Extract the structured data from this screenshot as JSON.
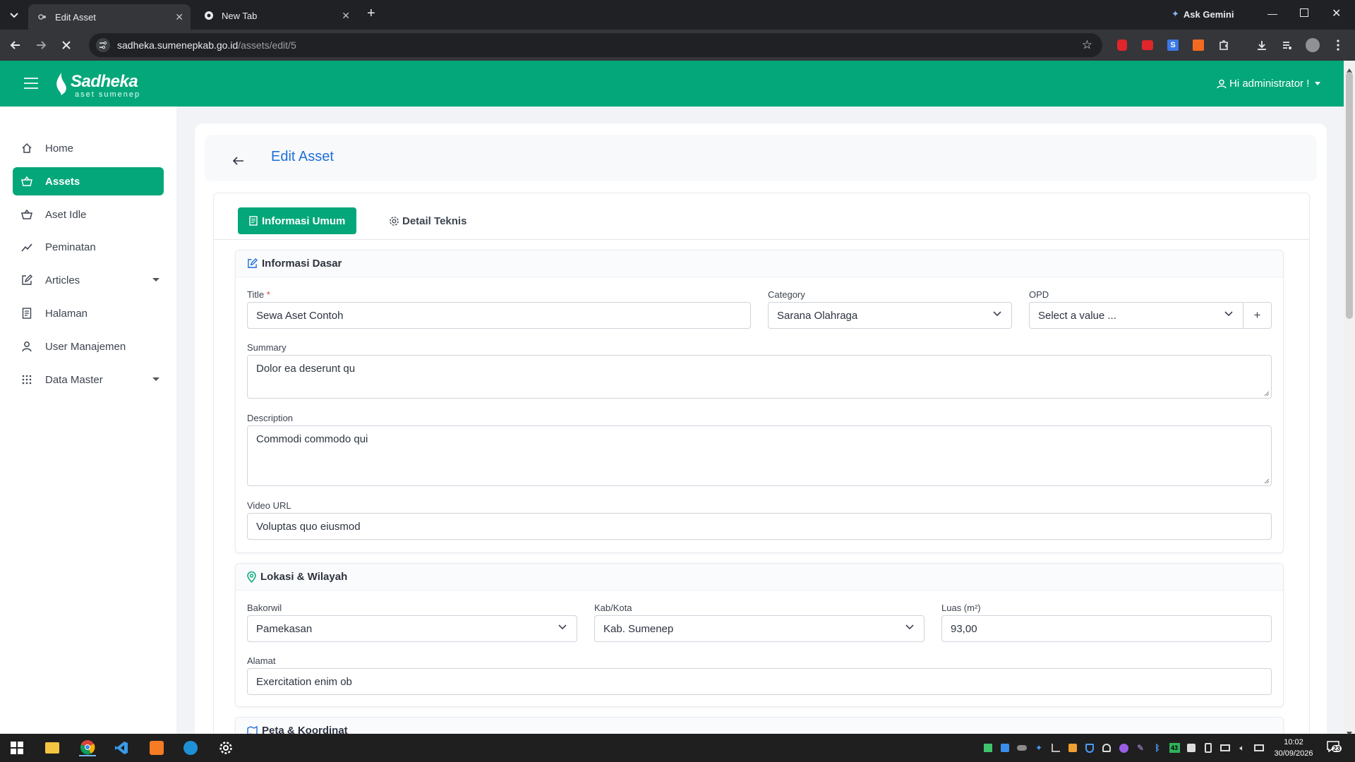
{
  "browser": {
    "tabs": [
      {
        "label": "Edit Asset",
        "active": true
      },
      {
        "label": "New Tab",
        "active": false
      }
    ],
    "new_tab_symbol": "+",
    "ask_gemini": "Ask Gemini",
    "url_host": "sadheka.sumenepkab.go.id",
    "url_path": "/assets/edit/5"
  },
  "header": {
    "logo_main": "Sadheka",
    "logo_sub": "aset sumenep",
    "user_greeting": "Hi administrator !"
  },
  "sidebar": {
    "items": [
      {
        "label": "Home",
        "icon": "home-icon"
      },
      {
        "label": "Assets",
        "icon": "basket-icon",
        "active": true
      },
      {
        "label": "Aset Idle",
        "icon": "basket-icon"
      },
      {
        "label": "Peminatan",
        "icon": "trend-icon"
      },
      {
        "label": "Articles",
        "icon": "edit-icon",
        "has_caret": true
      },
      {
        "label": "Halaman",
        "icon": "document-icon"
      },
      {
        "label": "User Manajemen",
        "icon": "user-icon"
      },
      {
        "label": "Data Master",
        "icon": "grid-icon",
        "has_caret": true
      }
    ]
  },
  "page": {
    "title": "Edit Asset",
    "tabs": [
      {
        "label": "Informasi Umum",
        "active": true
      },
      {
        "label": "Detail Teknis",
        "active": false
      }
    ]
  },
  "informasi_dasar": {
    "heading": "Informasi Dasar",
    "title_label": "Title",
    "required_mark": "*",
    "title_value": "Sewa Aset Contoh",
    "category_label": "Category",
    "category_value": "Sarana Olahraga",
    "opd_label": "OPD",
    "opd_placeholder": "Select a value ...",
    "opd_add": "+",
    "summary_label": "Summary",
    "summary_value": "Dolor ea deserunt qu",
    "description_label": "Description",
    "description_value": "Commodi commodo qui",
    "video_label": "Video URL",
    "video_value": "Voluptas quo eiusmod"
  },
  "lokasi": {
    "heading": "Lokasi & Wilayah",
    "bakorwil_label": "Bakorwil",
    "bakorwil_value": "Pamekasan",
    "kabkota_label": "Kab/Kota",
    "kabkota_value": "Kab. Sumenep",
    "luas_label": "Luas (m²)",
    "luas_value": "93,00",
    "alamat_label": "Alamat",
    "alamat_value": "Exercitation enim ob"
  },
  "next_section": {
    "heading": "Peta & Koordinat"
  },
  "taskbar": {
    "time": "10:02",
    "date": "30/09/2026",
    "notif_count": "23",
    "tray_badge": "43"
  },
  "colors": {
    "brand": "#04a77a",
    "link": "#1f6fd8"
  }
}
